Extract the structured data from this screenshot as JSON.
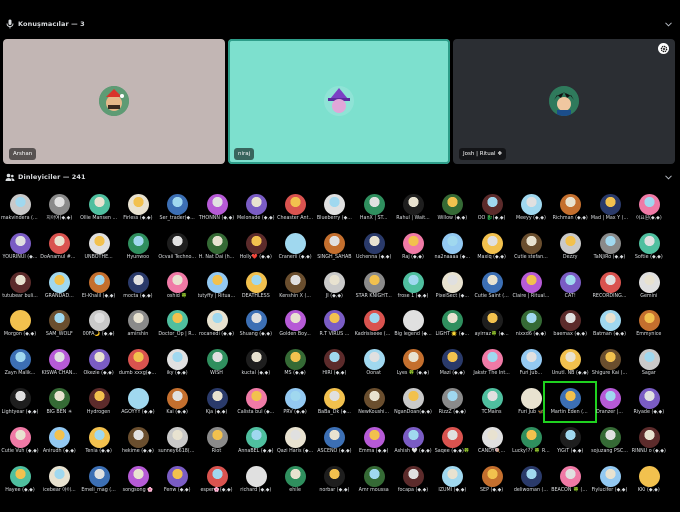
{
  "speakers_section": {
    "title": "Konuşmacılar — 3",
    "icon": "microphone-icon"
  },
  "speakers": [
    {
      "name": "Arshan",
      "bg": "#c2b6b4"
    },
    {
      "name": "niraj",
      "bg": "#7de0ce"
    },
    {
      "name": "Josh | Ritual ❖",
      "bg": "#2b2e33"
    }
  ],
  "listeners_section": {
    "title": "Dinleyiciler — 241",
    "icon": "listeners-icon"
  },
  "listeners": [
    [
      "makvindera (◆,◆)",
      "지아여(◆,◆)",
      "Ollie Mansen ...",
      "Firless (◆,◆)",
      "Ser_trader(◆...",
      "THONNN (◆,◆)",
      "Melonade (◆,◆)",
      "Cheaster Ant...",
      "Blueberry (◆...",
      "HanX | ST...",
      "Rahul | Wait...",
      "Willow (◆,◆)",
      "OO 🐉(◆,◆)",
      "Meeyy (◆,◆)",
      "Richman (◆,◆)",
      "Mad | Max Y (...",
      "이요원(◆,◆)"
    ],
    [
      "YOURINUI (◆...",
      "DoAnamul #0...",
      "UNBOTHE...",
      "Hyunwoo",
      "Ocvaii Techno...",
      "H. Nat Dai (h...",
      "Holly❤️ (◆,◆)",
      "Cranerii (◆,◆)",
      "SINGH_SAHAB",
      "Uchenna (◆,◆)",
      "Raj (◆,◆)",
      "na2naaaa (◆...",
      "Maxiq (◆,◆)",
      "Cutie stefan...",
      "Dezzy",
      "TaNJiRo (◆,◆)",
      "Softie (◆,◆)"
    ],
    [
      "tutubear buli...",
      "GRANDAD...",
      "El-Khalil (◆,◆)",
      "mocta (◆,◆)",
      "oshid 🍀",
      "tutyffy | Ritual...",
      "DEATHLESS",
      "Kenshin X (...",
      "JI (◆,◆)",
      "STAR KNIGHT...",
      "frose 1 (◆,◆)",
      "PixelSect (◆...",
      "Cutie Saint (...",
      "Claire | Ritual...",
      "CAT!",
      "RECORDING...",
      "Gemini"
    ],
    [
      "Morgon (◆,◆)",
      "SAM_WOLF",
      "00FA🌙 (◆,◆)",
      "amirshin",
      "Doctor_Op | R...",
      "rocanedi (◆,◆)",
      "Shuang (◆,◆)",
      "Golden Boy...",
      "R.T VIRUS ...",
      "Kadrisiseee (◆...",
      "Big legend (◆...",
      "LIGHT 🌟 (◆...",
      "ayirraz🍀 (◆...",
      "nixxd6 (◆,◆)",
      "baemax (◆,◆)",
      "Batman (◆,◆)",
      "Emmynice"
    ],
    [
      "Zayn Malik...",
      "KISWA CHAN...",
      "Okezie (◆,◆)",
      "dumb xxxg(◆,◆)",
      "iky (◆,◆)",
      "WISH",
      "kuctal (◆,◆)",
      "MS (◆,◆)",
      "HIRI (◆,◆)",
      "Oonat",
      "Lyes 🍀 (◆,◆)",
      "Mazi (◆,◆)",
      "Jakstr The Int...",
      "Furi Jub...",
      "Unutl. NB (◆,◆)",
      "Shigure Kai (...",
      "Sagar"
    ],
    [
      "Lightyear (◆,◆)",
      "BIG BEN ☀",
      "Hydrogen",
      "AGOYYY (◆,◆)",
      "Kai (◆,◆)",
      "Kja (◆,◆)",
      "Calista bul (◆...",
      "PRV (◆,◆)",
      "BaBa_Dk (◆...",
      "NewKoushi...",
      "NganDoan(◆,◆)",
      "RizzZ (◆,◆)",
      "TCMains",
      "Furi Jub 🦋",
      "Martin Eden (...",
      "Dranzer |...",
      "Riyade (◆,◆)"
    ],
    [
      "Cutie Vuh (◆,◆)",
      "Anirudh (◆,◆)",
      "Tenia (◆,◆)",
      "hekime (◆,◆)",
      "sunney6618(◆...",
      "Riot",
      "AnnaBEL (◆,◆)",
      "Qazi Haris (◆...",
      "ASCENO (◆,◆)",
      "Emma (◆,◆)",
      "Ashish 🤍 (◆,◆)",
      "Saqee (◆,◆)🍀",
      "CANDY🍭...",
      "Lucky!?? 🍀 R...",
      "YiGiT (◆,◆)",
      "sojuzang PSC...",
      "RINNU o (◆,◆)"
    ],
    [
      "Hayee (◆,◆)",
      "icebear 야이...",
      "Emeli_mag (...",
      "songsong 🌸",
      "Fenw (◆,◆)",
      "esper🌸(◆,◆)",
      "richard (◆,◆)",
      "ehile",
      "norbar (◆,◆)",
      "Amr moussa",
      "focapa (◆,◆)",
      "IZUMI (◆,◆)",
      "SEP (◆,◆)",
      "deliwoman (...",
      "BEACON 🍀 (◆...",
      "Fiylucifer (◆,◆)",
      "KKi (◆,◆)"
    ]
  ],
  "highlighted_listener": "Martin Eden (..."
}
